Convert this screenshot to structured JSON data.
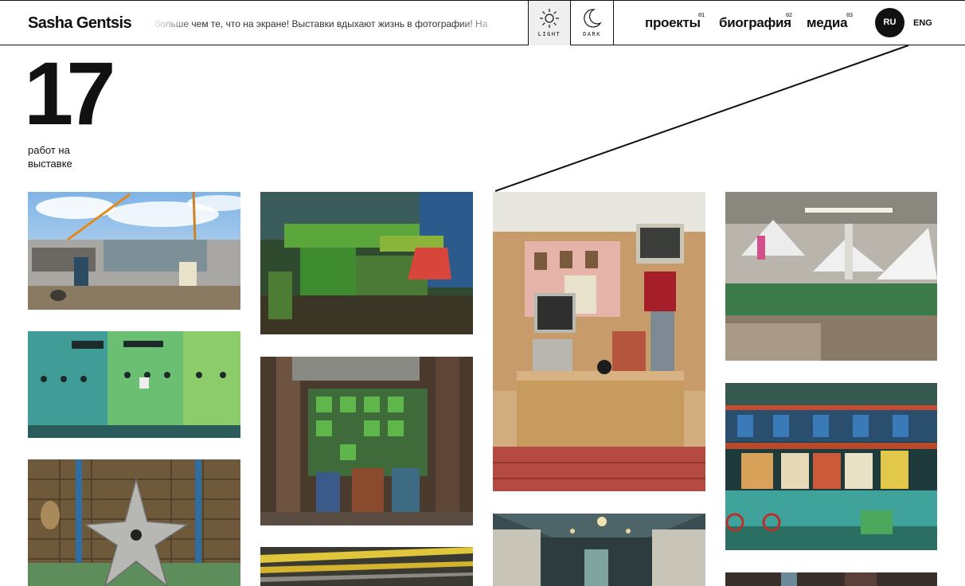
{
  "header": {
    "logo": "Sasha Gentsis",
    "ticker": "кут больше чем те, что на экране! Выставки вдыхают жизнь в фотографии! На",
    "theme": {
      "light_label": "LIGHT",
      "light_icon": "sun-icon",
      "dark_label": "DARK",
      "dark_icon": "moon-icon"
    },
    "nav": [
      {
        "label": "проекты",
        "num": "01"
      },
      {
        "label": "биография",
        "num": "02"
      },
      {
        "label": "медиа",
        "num": "03"
      }
    ],
    "lang": {
      "active": "RU",
      "other": "ENG"
    }
  },
  "counter": {
    "value": "17",
    "label": "работ на выставке"
  },
  "gallery": [
    {
      "id": "p1",
      "subject": "construction site with crane and fridge"
    },
    {
      "id": "p2",
      "subject": "green control panels"
    },
    {
      "id": "p3",
      "subject": "metal star in tiled hall"
    },
    {
      "id": "p4",
      "subject": "green lathe machine"
    },
    {
      "id": "p5",
      "subject": "rusty industrial wall"
    },
    {
      "id": "p6",
      "subject": "yellow ceiling pipes"
    },
    {
      "id": "p7",
      "subject": "office desk with monitor"
    },
    {
      "id": "p8",
      "subject": "corridor with lamps"
    },
    {
      "id": "p9",
      "subject": "workshop with white hoods"
    },
    {
      "id": "p10",
      "subject": "green pipes with posters"
    },
    {
      "id": "p11",
      "subject": "partial photo"
    }
  ],
  "colors": {
    "accent": "#111111",
    "background": "#ffffff",
    "light_btn_bg": "#efefef"
  }
}
